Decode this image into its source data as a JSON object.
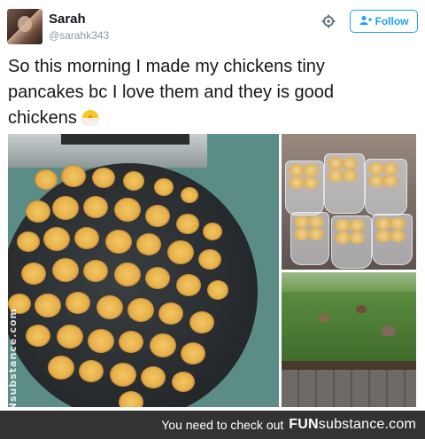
{
  "user": {
    "name": "Sarah",
    "handle": "@sarahk343"
  },
  "actions": {
    "follow_label": "Follow",
    "gear_icon": "gear-icon",
    "follow_icon": "add-person-icon"
  },
  "tweet": {
    "text": "So this morning I made my chickens tiny pancakes bc I love them and they is good chickens",
    "emoji": "hatching-chick-emoji"
  },
  "watermark": {
    "side_text": "FUNsubstance.com"
  },
  "footer": {
    "text": "You need to check out",
    "brand_bold": "FUN",
    "brand_rest": "substance.com"
  },
  "colors": {
    "accent": "#1da1f2",
    "footer_bg": "#333333"
  }
}
